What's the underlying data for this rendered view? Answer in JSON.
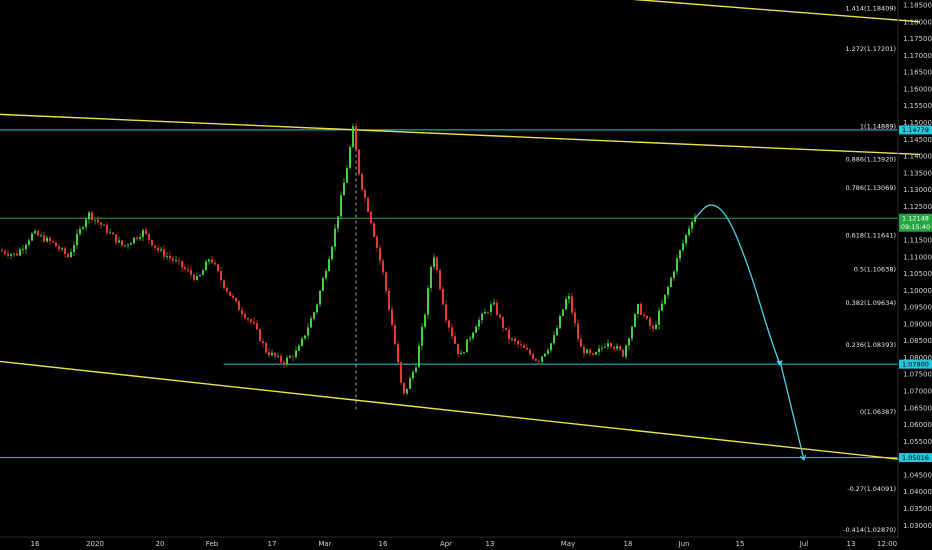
{
  "chart_data": {
    "type": "candlestick",
    "ylim": [
      1.0265,
      1.1865
    ],
    "price_axis_labels": [
      "1.18500",
      "1.18000",
      "1.17500",
      "1.17000",
      "1.16500",
      "1.16000",
      "1.15500",
      "1.15000",
      "1.14500",
      "1.14000",
      "1.13500",
      "1.13000",
      "1.12500",
      "1.12000",
      "1.11500",
      "1.11000",
      "1.10500",
      "1.10000",
      "1.09500",
      "1.09000",
      "1.08500",
      "1.08000",
      "1.07500",
      "1.07000",
      "1.06500",
      "1.06000",
      "1.05500",
      "1.05000",
      "1.04500",
      "1.04000",
      "1.03500",
      "1.03000"
    ],
    "time_axis_labels": [
      "16",
      "2020",
      "20",
      "Feb",
      "17",
      "Mar",
      "16",
      "Apr",
      "13",
      "May",
      "18",
      "Jun",
      "15",
      "Jul",
      "13",
      "12:00"
    ],
    "fib_levels": [
      {
        "label": "1.414(1.18409)",
        "price": 1.18409
      },
      {
        "label": "1.272(1.17201)",
        "price": 1.17201
      },
      {
        "label": "1(1.14889)",
        "price": 1.14889
      },
      {
        "label": "0.886(1.13920)",
        "price": 1.1392
      },
      {
        "label": "0.786(1.13069)",
        "price": 1.13069
      },
      {
        "label": "0.618(1.11641)",
        "price": 1.11641
      },
      {
        "label": "0.5(1.10638)",
        "price": 1.10638
      },
      {
        "label": "0.382(1.09634)",
        "price": 1.09634
      },
      {
        "label": "0.236(1.08393)",
        "price": 1.08393
      },
      {
        "label": "0(1.06387)",
        "price": 1.06387
      },
      {
        "label": "-0.27(1.04091)",
        "price": 1.04091
      },
      {
        "label": "-0.414(1.02870)",
        "price": 1.0287
      }
    ],
    "horizontal_lines": [
      {
        "price": 1.14779,
        "label": "1.14779",
        "color": "#26c6da",
        "x_start": 0.0
      },
      {
        "price": 1.12148,
        "label": "1.12148",
        "color": "#2ea043",
        "x_start": 0.0
      },
      {
        "price": 1.078,
        "label": "1.07800",
        "color": "#26c6da",
        "x_start": 0.24
      },
      {
        "price": 1.05016,
        "label": "1.05016",
        "color": "#26c6da",
        "x_start": 0.0
      }
    ],
    "current_price": {
      "price": 1.12148,
      "countdown": "09:15:40"
    },
    "trendlines": [
      {
        "from": {
          "t": -6,
          "p": 1.1525
        },
        "to": {
          "t": 920,
          "p": 1.1405
        }
      },
      {
        "from": {
          "t": -6,
          "p": 1.079
        },
        "to": {
          "t": 920,
          "p": 1.049
        }
      },
      {
        "from": {
          "t": 620,
          "p": 1.187
        },
        "to": {
          "t": 920,
          "p": 1.18
        }
      }
    ],
    "path": [
      {
        "t": 0,
        "p": 1.112
      },
      {
        "t": 18,
        "p": 1.1105
      },
      {
        "t": 35,
        "p": 1.117
      },
      {
        "t": 55,
        "p": 1.114
      },
      {
        "t": 70,
        "p": 1.11
      },
      {
        "t": 90,
        "p": 1.123
      },
      {
        "t": 105,
        "p": 1.119
      },
      {
        "t": 125,
        "p": 1.113
      },
      {
        "t": 145,
        "p": 1.1175
      },
      {
        "t": 160,
        "p": 1.112
      },
      {
        "t": 180,
        "p": 1.108
      },
      {
        "t": 200,
        "p": 1.103
      },
      {
        "t": 212,
        "p": 1.11
      },
      {
        "t": 225,
        "p": 1.102
      },
      {
        "t": 240,
        "p": 1.095
      },
      {
        "t": 255,
        "p": 1.09
      },
      {
        "t": 268,
        "p": 1.082
      },
      {
        "t": 285,
        "p": 1.0785
      },
      {
        "t": 300,
        "p": 1.082
      },
      {
        "t": 318,
        "p": 1.095
      },
      {
        "t": 335,
        "p": 1.115
      },
      {
        "t": 348,
        "p": 1.135
      },
      {
        "t": 355,
        "p": 1.148
      },
      {
        "t": 362,
        "p": 1.133
      },
      {
        "t": 372,
        "p": 1.122
      },
      {
        "t": 385,
        "p": 1.105
      },
      {
        "t": 395,
        "p": 1.088
      },
      {
        "t": 405,
        "p": 1.068
      },
      {
        "t": 418,
        "p": 1.078
      },
      {
        "t": 428,
        "p": 1.095
      },
      {
        "t": 435,
        "p": 1.112
      },
      {
        "t": 448,
        "p": 1.092
      },
      {
        "t": 462,
        "p": 1.08
      },
      {
        "t": 478,
        "p": 1.09
      },
      {
        "t": 495,
        "p": 1.096
      },
      {
        "t": 510,
        "p": 1.086
      },
      {
        "t": 528,
        "p": 1.082
      },
      {
        "t": 540,
        "p": 1.079
      },
      {
        "t": 555,
        "p": 1.085
      },
      {
        "t": 570,
        "p": 1.099
      },
      {
        "t": 582,
        "p": 1.083
      },
      {
        "t": 595,
        "p": 1.08
      },
      {
        "t": 610,
        "p": 1.085
      },
      {
        "t": 625,
        "p": 1.081
      },
      {
        "t": 640,
        "p": 1.095
      },
      {
        "t": 655,
        "p": 1.088
      },
      {
        "t": 668,
        "p": 1.099
      },
      {
        "t": 680,
        "p": 1.11
      },
      {
        "t": 695,
        "p": 1.122
      }
    ],
    "projection": {
      "points": [
        {
          "t": 695,
          "p": 1.1215
        },
        {
          "t": 710,
          "p": 1.1265
        },
        {
          "t": 728,
          "p": 1.1225
        },
        {
          "t": 750,
          "p": 1.106
        },
        {
          "t": 768,
          "p": 1.088
        },
        {
          "t": 780,
          "p": 1.0778
        }
      ],
      "second_leg": [
        {
          "t": 780,
          "p": 1.079
        },
        {
          "t": 804,
          "p": 1.0495
        }
      ],
      "color": "#4dd0e1"
    },
    "vertical_marker": {
      "t": 356,
      "p_from": 1.0645,
      "p_to": 1.1475
    }
  }
}
